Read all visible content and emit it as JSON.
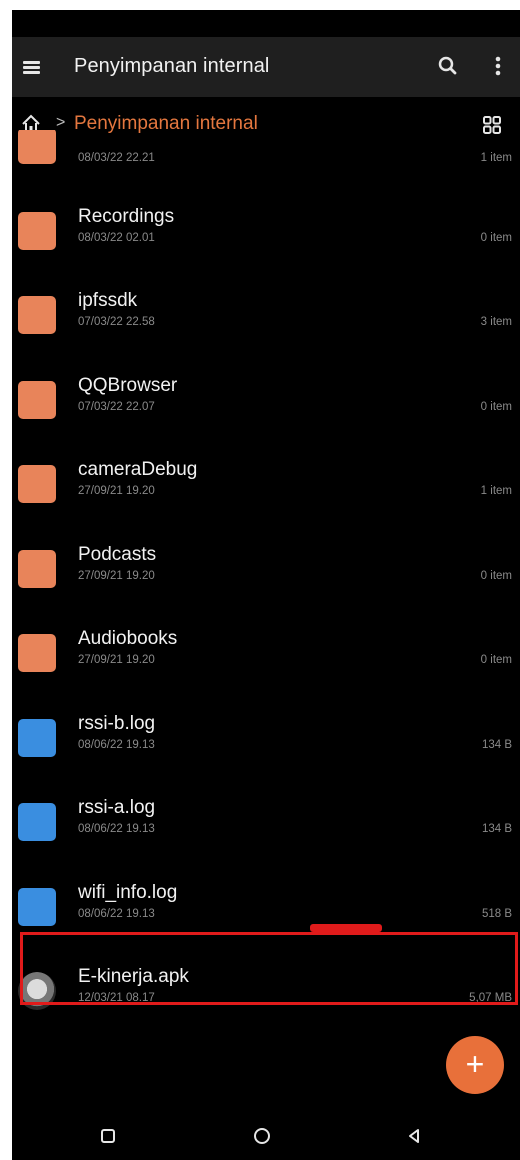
{
  "appbar": {
    "title": "Penyimpanan internal"
  },
  "breadcrumb": {
    "separator": ">",
    "current": "Penyimpanan internal"
  },
  "files": [
    {
      "name": "",
      "date": "08/03/22 22.21",
      "meta": "1 item",
      "type": "folder",
      "partial": true
    },
    {
      "name": "Recordings",
      "date": "08/03/22 02.01",
      "meta": "0 item",
      "type": "folder"
    },
    {
      "name": "ipfssdk",
      "date": "07/03/22 22.58",
      "meta": "3 item",
      "type": "folder"
    },
    {
      "name": "QQBrowser",
      "date": "07/03/22 22.07",
      "meta": "0 item",
      "type": "folder"
    },
    {
      "name": "cameraDebug",
      "date": "27/09/21 19.20",
      "meta": "1 item",
      "type": "folder"
    },
    {
      "name": "Podcasts",
      "date": "27/09/21 19.20",
      "meta": "0 item",
      "type": "folder"
    },
    {
      "name": "Audiobooks",
      "date": "27/09/21 19.20",
      "meta": "0 item",
      "type": "folder"
    },
    {
      "name": "rssi-b.log",
      "date": "08/06/22 19.13",
      "meta": "134 B",
      "type": "log"
    },
    {
      "name": "rssi-a.log",
      "date": "08/06/22 19.13",
      "meta": "134 B",
      "type": "log"
    },
    {
      "name": "wifi_info.log",
      "date": "08/06/22 19.13",
      "meta": "518 B",
      "type": "log"
    },
    {
      "name": "E-kinerja.apk",
      "date": "12/03/21 08.17",
      "meta": "5,07 MB",
      "type": "apk"
    }
  ],
  "fab": {
    "label": "+"
  },
  "colors": {
    "accent": "#e4773f",
    "folder": "#e8845a",
    "log": "#3a8ee0",
    "highlight": "#e01b1b",
    "background": "#000000"
  },
  "icons": {
    "menu": "menu-icon",
    "search": "search-icon",
    "more": "more-vert-icon",
    "home": "home-icon",
    "grid": "grid-view-icon",
    "folder": "folder-icon",
    "log": "log-file-icon",
    "apk": "apk-icon",
    "recent": "recent-apps-icon",
    "navhome": "nav-home-icon",
    "back": "back-icon"
  }
}
